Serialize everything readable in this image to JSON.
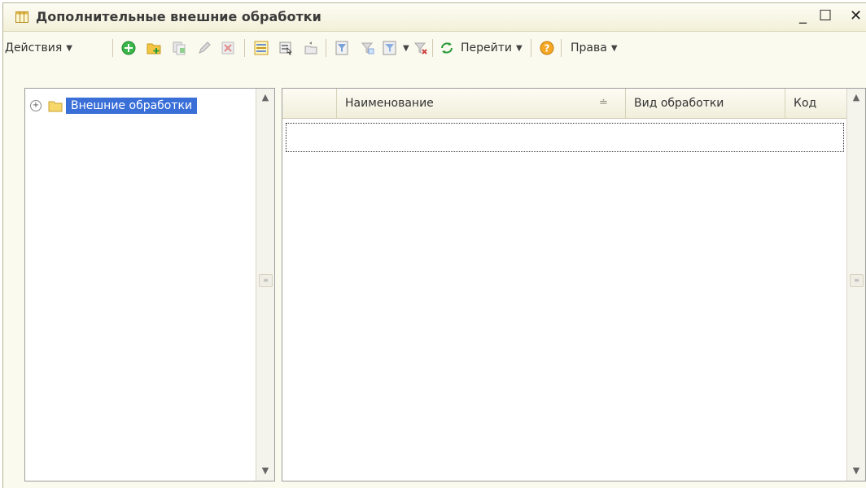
{
  "window": {
    "title": "Дополнительные внешние обработки",
    "min_glyph": "_",
    "max_glyph": "☐",
    "close_glyph": "✕"
  },
  "toolbar": {
    "actions_label": "Действия",
    "goto_label": "Перейти",
    "rights_label": "Права",
    "icons": [
      "add-icon",
      "add-group-icon",
      "copy-icon",
      "edit-icon",
      "delete-icon",
      "hierarchy-icon",
      "select-icon",
      "level-up-icon",
      "filter-icon",
      "filter-value-icon",
      "filter-list-icon",
      "clear-filter-icon",
      "refresh-icon",
      "help-icon"
    ]
  },
  "tree": {
    "root_label": "Внешние обработки",
    "expand_glyph": "+"
  },
  "table": {
    "columns": [
      "Наименование",
      "Вид обработки",
      "Код"
    ],
    "rows": []
  },
  "colors": {
    "window_bg": "#fbfaef",
    "selection": "#3a6fd8",
    "add_green": "#39b54a",
    "help_orange": "#f5a623"
  }
}
